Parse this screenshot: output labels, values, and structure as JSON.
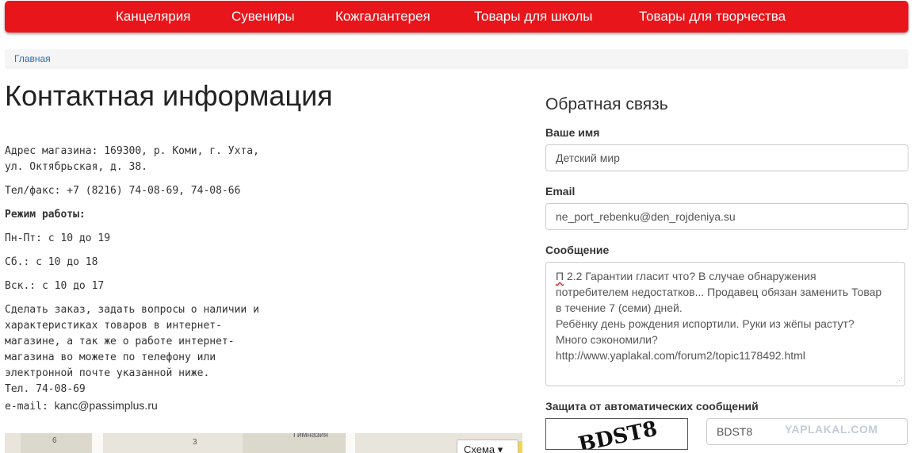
{
  "nav": {
    "items": [
      "Канцелярия",
      "Сувениры",
      "Кожгалантерея",
      "Товары для школы",
      "Товары для творчества"
    ]
  },
  "breadcrumb": {
    "home": "Главная"
  },
  "page": {
    "title": "Контактная информация"
  },
  "contact": {
    "address_line1": "Адрес магазина: 169300, р. Коми, г. Ухта,",
    "address_line2": "ул. Октябрьская, д. 38.",
    "phone": "Тел/факс: +7 (8216) 74-08-69, 74-08-66",
    "hours_title": "Режим работы:",
    "hours_weekdays": "Пн-Пт: с 10 до 19",
    "hours_saturday": "Сб.: с 10 до 18",
    "hours_sunday": "Вск.: с 10 до 17",
    "order_lines": [
      "Сделать заказ, задать вопросы о наличии и",
      "характеристиках товаров в интернет-",
      "магазине, а так же о работе интернет-",
      "магазина во можете по телефону или",
      "электронной почте указанной ниже."
    ],
    "phone_short": "Тел. 74-08-69",
    "email_prefix": "e-mail: ",
    "email": "kanc@passimplus.ru"
  },
  "map": {
    "labels": [
      "6",
      "Гимназия",
      "3"
    ],
    "scheme_label": "Схема ▾"
  },
  "feedback": {
    "title": "Обратная связь",
    "name_label": "Ваше имя",
    "name_value": "Детский мир",
    "email_label": "Email",
    "email_value": "ne_port_rebenku@den_rojdeniya.su",
    "message_label": "Сообщение",
    "message_first_word": "П",
    "message_text": " 2.2 Гарантии гласит что? В случае обнаружения\nпотребителем недостатков... Продавец обязан заменить Товар\nв течение 7 (семи) дней.\nРебёнку день рождения испортили. Руки из жёпы растут?\nМного сэкономили?\nhttp://www.yaplakal.com/forum2/topic1178492.html",
    "captcha_label": "Защита от автоматических сообщений",
    "captcha_image_text": "BDST8",
    "captcha_value": "BDST8"
  },
  "watermark": "YAPLAKAL.COM",
  "colors": {
    "navbar": "#e8161b",
    "link": "#2a6cb5"
  }
}
